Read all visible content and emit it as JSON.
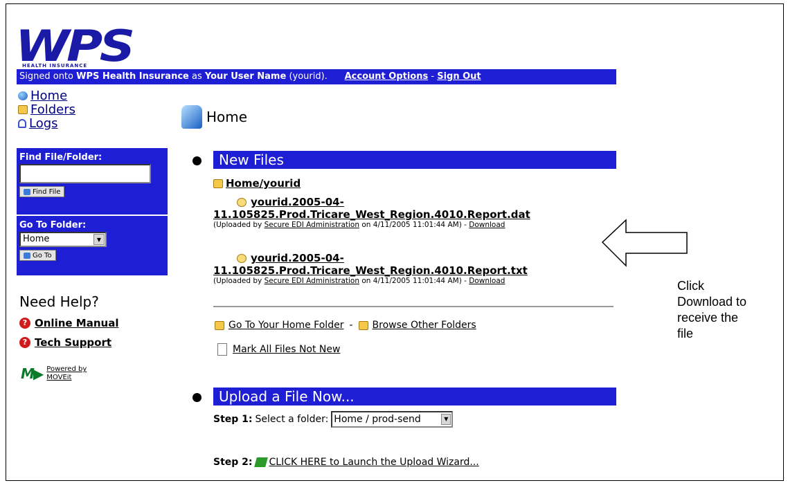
{
  "header": {
    "logo_text": "WPS",
    "logo_subtext": "HEALTH INSURANCE",
    "signon_prefix": "Signed onto",
    "signon_org": "WPS Health Insurance",
    "signon_as": "as",
    "signon_user": "Your User Name",
    "signon_id": "(yourid).",
    "account_options": "Account Options",
    "separator": "-",
    "sign_out": "Sign Out"
  },
  "sidebar": {
    "nav": [
      {
        "label": "Home",
        "icon": "globe-icon"
      },
      {
        "label": "Folders",
        "icon": "folder-icon"
      },
      {
        "label": "Logs",
        "icon": "log-icon"
      }
    ],
    "find": {
      "title": "Find File/Folder:",
      "input_value": "",
      "button_label": "Find File"
    },
    "goto": {
      "title": "Go To Folder:",
      "selected": "Home",
      "button_label": "Go To"
    },
    "help": {
      "title": "Need Help?",
      "online_manual": "Online Manual",
      "tech_support": "Tech Support"
    },
    "powered": {
      "line1": "Powered by",
      "line2": "MOVEit"
    }
  },
  "main": {
    "title": "Home",
    "new_files": {
      "heading": "New Files",
      "folder": "Home/yourid",
      "files": [
        {
          "name_line1": "yourid.2005-04-",
          "name_line2": "11.105825.Prod.Tricare_West_Region.4010.Report.dat",
          "meta_prefix": "(Uploaded by",
          "uploader": "Secure EDI Administration",
          "meta_on": "on 4/11/2005 11:01:44 AM) -",
          "download": "Download"
        },
        {
          "name_line1": "yourid.2005-04-",
          "name_line2": "11.105825.Prod.Tricare_West_Region.4010.Report.txt",
          "meta_prefix": "(Uploaded by",
          "uploader": "Secure EDI Administration",
          "meta_on": "on 4/11/2005 11:01:44 AM) -",
          "download": "Download"
        }
      ],
      "go_home_folder": "Go To Your Home Folder",
      "dash": "-",
      "browse_folders": "Browse Other Folders",
      "mark_all": "Mark All Files Not New"
    },
    "upload": {
      "heading": "Upload a File Now...",
      "step1_label": "Step 1:",
      "step1_text": "Select a folder:",
      "step1_selected": "Home / prod-send",
      "step2_label": "Step 2:",
      "step2_link": "CLICK HERE to Launch the Upload Wizard..."
    }
  },
  "annotation": {
    "lines": [
      "Click",
      "Download to",
      "receive the",
      "file"
    ]
  },
  "colors": {
    "bar_blue": "#1e1ed4",
    "logo_blue": "#1a1aa6"
  }
}
